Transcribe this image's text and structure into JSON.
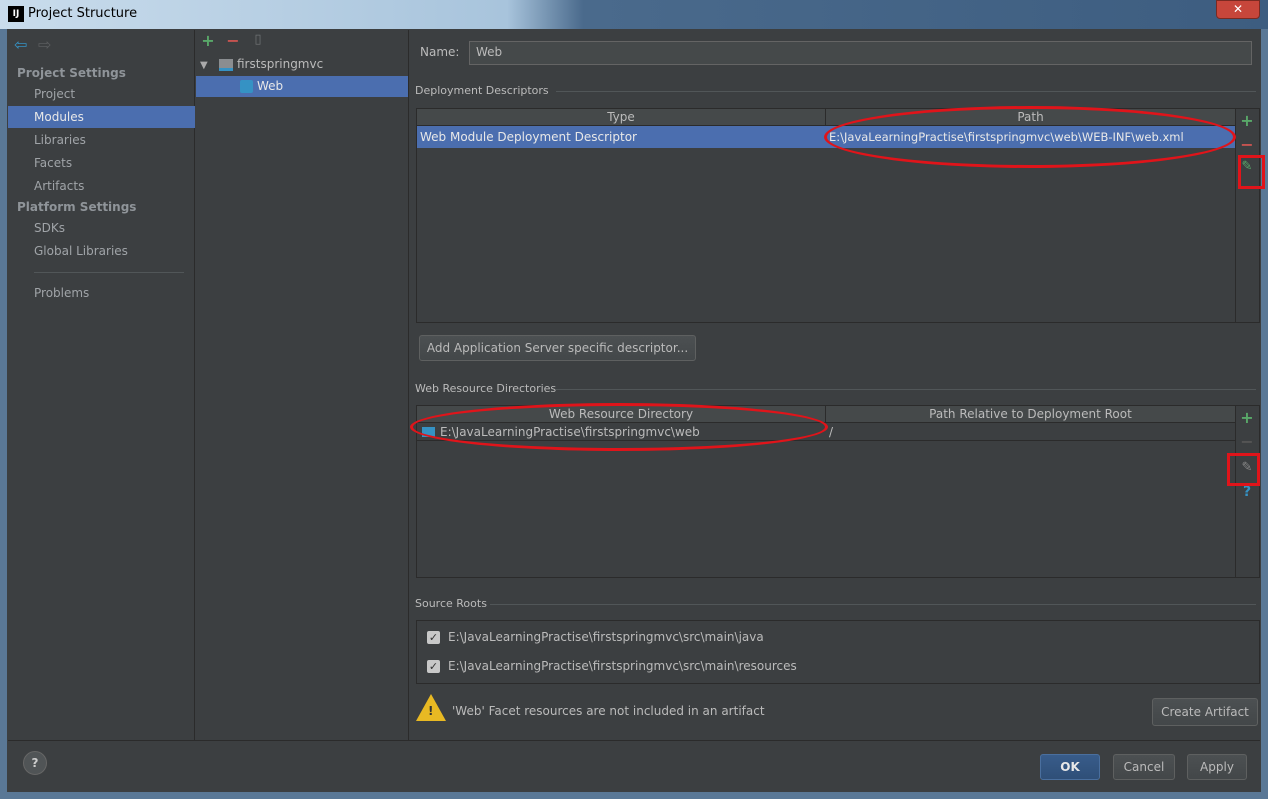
{
  "window": {
    "title": "Project Structure",
    "logo": "IJ",
    "close": "✕"
  },
  "sidebar": {
    "project_settings": "Project Settings",
    "items": [
      {
        "label": "Project"
      },
      {
        "label": "Modules"
      },
      {
        "label": "Libraries"
      },
      {
        "label": "Facets"
      },
      {
        "label": "Artifacts"
      }
    ],
    "platform_settings": "Platform Settings",
    "platform_items": [
      {
        "label": "SDKs"
      },
      {
        "label": "Global Libraries"
      }
    ],
    "problems": "Problems"
  },
  "tree": {
    "root": "firstspringmvc",
    "child": "Web"
  },
  "main": {
    "name_label": "Name:",
    "name_value": "Web",
    "deployment": {
      "title": "Deployment Descriptors",
      "columns": [
        "Type",
        "Path"
      ],
      "rows": [
        {
          "type": "Web Module Deployment Descriptor",
          "path": "E:\\JavaLearningPractise\\firstspringmvc\\web\\WEB-INF\\web.xml"
        }
      ]
    },
    "add_server_button": "Add Application Server specific descriptor...",
    "resources": {
      "title": "Web Resource Directories",
      "columns": [
        "Web Resource Directory",
        "Path Relative to Deployment Root"
      ],
      "rows": [
        {
          "dir": "E:\\JavaLearningPractise\\firstspringmvc\\web",
          "rel": "/"
        }
      ]
    },
    "source_roots": {
      "title": "Source Roots",
      "items": [
        {
          "path": "E:\\JavaLearningPractise\\firstspringmvc\\src\\main\\java",
          "checked": true
        },
        {
          "path": "E:\\JavaLearningPractise\\firstspringmvc\\src\\main\\resources",
          "checked": true
        }
      ]
    },
    "warning": "'Web' Facet resources are not included in an artifact",
    "create_artifact": "Create Artifact"
  },
  "footer": {
    "help": "?",
    "ok": "OK",
    "cancel": "Cancel",
    "apply": "Apply"
  },
  "colors": {
    "selection": "#4b6eaf",
    "annotation": "#e0141a",
    "add": "#59a869",
    "remove": "#c75450"
  }
}
